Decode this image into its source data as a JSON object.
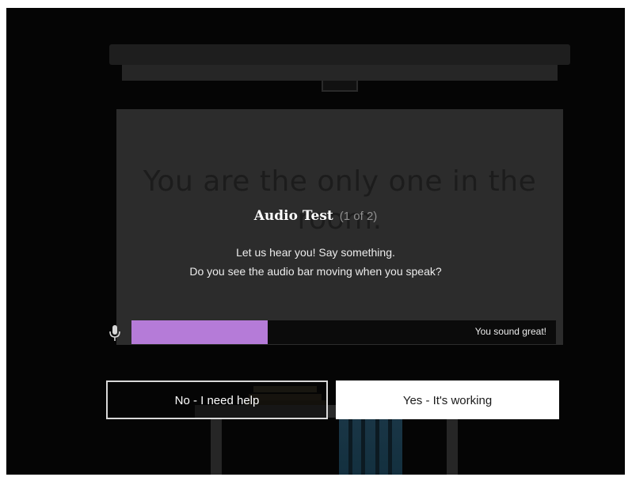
{
  "background": {
    "message": "You are the only one in the room."
  },
  "dialog": {
    "title": "Audio Test",
    "step": "(1 of 2)",
    "line1": "Let us hear you! Say something.",
    "line2": "Do you see the audio bar moving when you speak?"
  },
  "audio": {
    "level": 0.32,
    "status": "You sound great!",
    "fill_color": "#b57bd8",
    "icon": "microphone-icon"
  },
  "buttons": {
    "no_label": "No - I need help",
    "yes_label": "Yes - It's working"
  }
}
